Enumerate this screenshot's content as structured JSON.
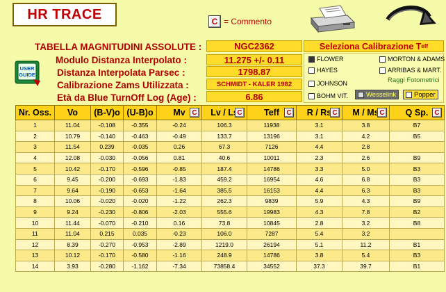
{
  "app": {
    "title": "HR TRACE",
    "comment_button": "C",
    "comment_label": "= Commento"
  },
  "header": {
    "table_label": "TABELLA MAGNITUDINI ASSOLUTE :",
    "cluster_name": "NGC2362",
    "modulo_label": "Modulo Distanza Interpolato :",
    "modulo_value": "11.275 +/- 0.11",
    "distanza_label": "Distanza Interpolata Parsec :",
    "distanza_value": "1798.87",
    "calibrazione_label": "Calibrazione Zams Utilizzata :",
    "calibrazione_value": "SCHMIDT - KALER 1982",
    "eta_label": "Età da Blue TurnOff Log (Age) :",
    "eta_value": "6.86"
  },
  "calibration": {
    "title": "Seleziona Calibrazione Teff",
    "title_main": "Seleziona Calibrazione T",
    "title_sub": "eff",
    "options": [
      {
        "label": "FLOWER",
        "checked": true
      },
      {
        "label": "MORTON & ADAMS",
        "checked": false
      },
      {
        "label": "HAYES",
        "checked": false
      },
      {
        "label": "ARRIBAS & MART.",
        "checked": false
      },
      {
        "label": "JOHNSON",
        "checked": false
      },
      {
        "label": "BOHM VIT.",
        "checked": false
      }
    ],
    "raggi_label": "Raggi Fotometrici",
    "wesselink_label": "Wesselink",
    "popper_label": "Popper"
  },
  "guide": {
    "line1": "USER",
    "line2": "GUIDE"
  },
  "table": {
    "headers": [
      "Nr. Oss.",
      "Vo",
      "(B-V)o",
      "(U-B)o",
      "Mv",
      "Lv / Ls",
      "Teff",
      "R / Rs",
      "M / Ms",
      "Q Sp."
    ],
    "header_c": "C",
    "rows": [
      [
        "1",
        "11.04",
        "-0.108",
        "-0.355",
        "-0.24",
        "106.3",
        "11938",
        "3.1",
        "3.8",
        "B7"
      ],
      [
        "2",
        "10.79",
        "-0.140",
        "-0.463",
        "-0.49",
        "133.7",
        "13196",
        "3.1",
        "4.2",
        "B5"
      ],
      [
        "3",
        "11.54",
        "0.239",
        "-0.035",
        "0.26",
        "67.3",
        "7126",
        "4.4",
        "2.8",
        ""
      ],
      [
        "4",
        "12.08",
        "-0.030",
        "-0.056",
        "0.81",
        "40.6",
        "10011",
        "2.3",
        "2.6",
        "B9"
      ],
      [
        "5",
        "10.42",
        "-0.170",
        "-0.596",
        "-0.85",
        "187.4",
        "14786",
        "3.3",
        "5.0",
        "B3"
      ],
      [
        "6",
        "9.45",
        "-0.200",
        "-0.693",
        "-1.83",
        "459.2",
        "16954",
        "4.6",
        "6.8",
        "B3"
      ],
      [
        "7",
        "9.64",
        "-0.190",
        "-0.653",
        "-1.64",
        "385.5",
        "16153",
        "4.4",
        "6.3",
        "B3"
      ],
      [
        "8",
        "10.06",
        "-0.020",
        "-0.020",
        "-1.22",
        "262.3",
        "9839",
        "5.9",
        "4.3",
        "B9"
      ],
      [
        "9",
        "9.24",
        "-0.230",
        "-0.806",
        "-2.03",
        "555.6",
        "19983",
        "4.3",
        "7.8",
        "B2"
      ],
      [
        "10",
        "11.44",
        "-0.070",
        "-0.210",
        "0.16",
        "73.8",
        "10845",
        "2.8",
        "3.2",
        "B8"
      ],
      [
        "11",
        "11.04",
        "0.215",
        "0.035",
        "-0.23",
        "106.0",
        "7287",
        "5.4",
        "3.2",
        ""
      ],
      [
        "12",
        "8.39",
        "-0.270",
        "-0.953",
        "-2.89",
        "1219.0",
        "26194",
        "5.1",
        "11.2",
        "B1"
      ],
      [
        "13",
        "10.12",
        "-0.170",
        "-0.580",
        "-1.16",
        "248.9",
        "14786",
        "3.8",
        "5.4",
        "B3"
      ],
      [
        "14",
        "3.93",
        "-0.280",
        "-1.162",
        "-7.34",
        "73858.4",
        "34552",
        "37.3",
        "39.7",
        "B1"
      ]
    ]
  },
  "colors": {
    "accent_red": "#c00000",
    "panel_yellow": "#ffdb2a",
    "background": "#f5fba8"
  },
  "icons": [
    "printer-icon",
    "back-arrow-icon",
    "user-guide-icon"
  ]
}
